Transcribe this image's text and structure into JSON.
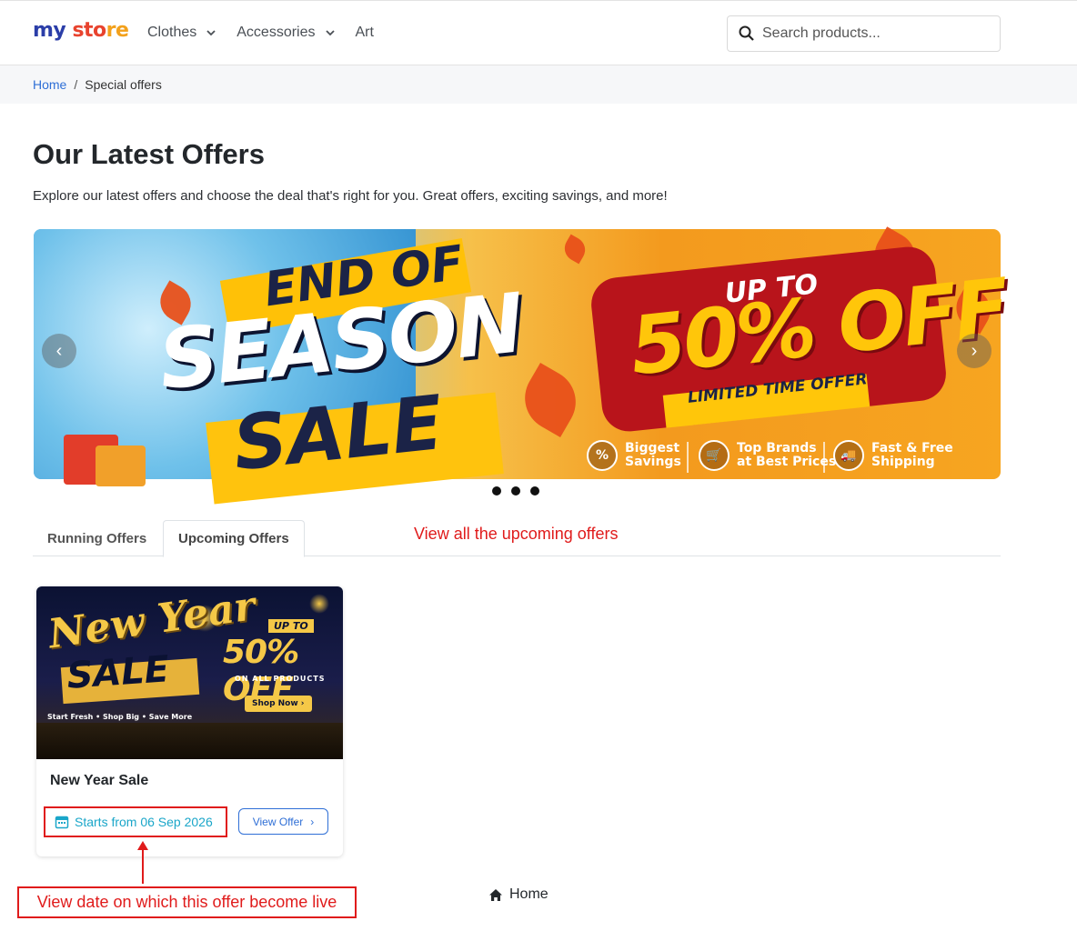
{
  "brand": {
    "part1": "my",
    "part2": "sto",
    "part3": "re"
  },
  "nav": {
    "items": [
      {
        "label": "Clothes",
        "has_dropdown": true
      },
      {
        "label": "Accessories",
        "has_dropdown": true
      },
      {
        "label": "Art",
        "has_dropdown": false
      }
    ]
  },
  "search": {
    "placeholder": "Search products...",
    "value": "",
    "icon": "search-icon"
  },
  "breadcrumb": {
    "home": "Home",
    "separator": "/",
    "current": "Special offers"
  },
  "page": {
    "title": "Our Latest Offers",
    "intro": "Explore our latest offers and choose the deal that's right for you. Great offers, exciting savings, and more!"
  },
  "banner": {
    "line1": "END OF",
    "line2": "SEASON",
    "line3": "SALE",
    "upto": "UP TO",
    "discount": "50% OFF",
    "limited": "LIMITED TIME OFFER",
    "features": [
      {
        "line1": "Biggest",
        "line2": "Savings",
        "icon": "%"
      },
      {
        "line1": "Top Brands",
        "line2": "at Best Prices",
        "icon": "🛒"
      },
      {
        "line1": "Fast & Free",
        "line2": "Shipping",
        "icon": "🚚"
      }
    ],
    "prev_icon": "‹",
    "next_icon": "›",
    "slide_count": 3
  },
  "tabs": [
    {
      "label": "Running Offers",
      "active": false
    },
    {
      "label": "Upcoming Offers",
      "active": true
    }
  ],
  "annotations": {
    "top": "View all the upcoming offers",
    "bottom": "View date on which this offer become live"
  },
  "offer_card": {
    "image": {
      "headline1": "New Year",
      "headline2": "SALE",
      "upto": "UP TO",
      "discount": "50% OFF",
      "sub": "ON ALL PRODUCTS",
      "cta": "Shop Now ›",
      "tagline": "Start Fresh  •  Shop Big  •  Save More"
    },
    "title": "New Year Sale",
    "starts": "Starts from 06 Sep 2026",
    "button": "View Offer",
    "button_icon": "›"
  },
  "footer": {
    "home": "Home"
  },
  "colors": {
    "link": "#2f6fd6",
    "annotation": "#e01b1b",
    "date": "#1aa6c9"
  }
}
